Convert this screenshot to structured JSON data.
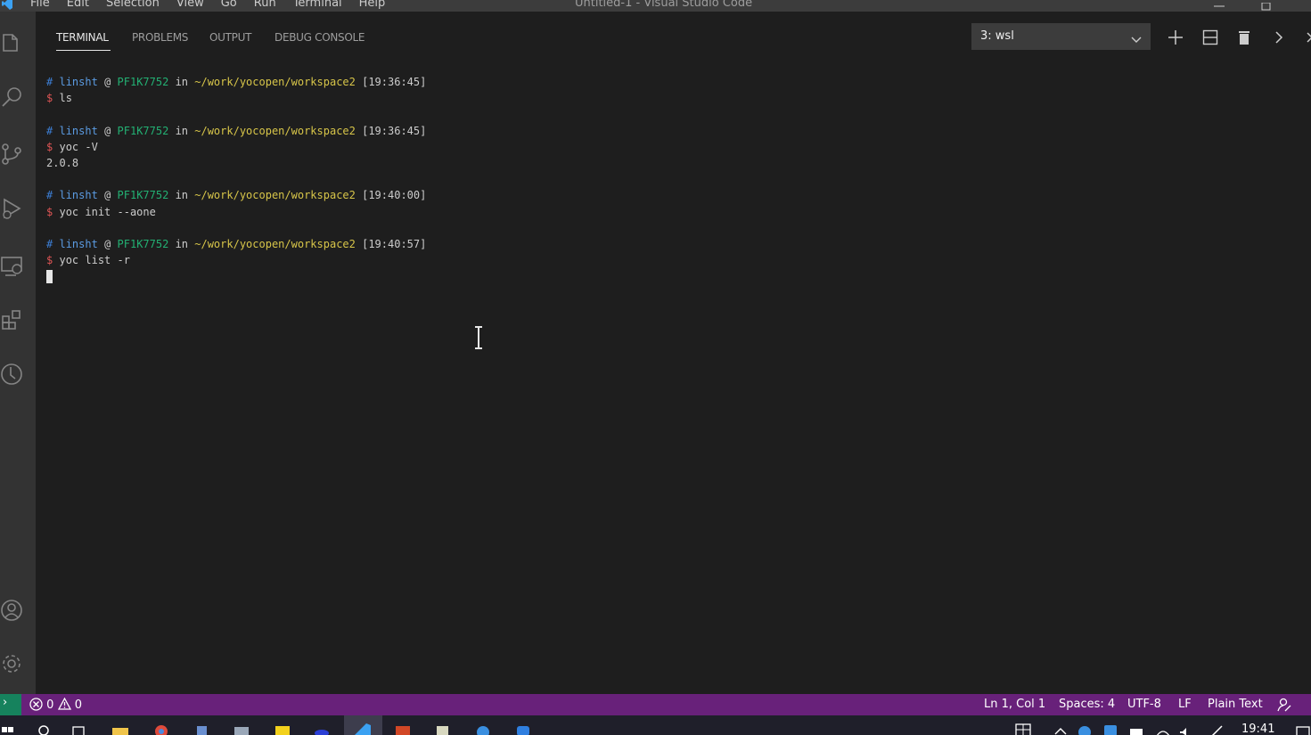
{
  "window": {
    "title": "Untitled-1 - Visual Studio Code",
    "menu": [
      "File",
      "Edit",
      "Selection",
      "View",
      "Go",
      "Run",
      "Terminal",
      "Help"
    ]
  },
  "panel": {
    "tabs": [
      "TERMINAL",
      "PROBLEMS",
      "OUTPUT",
      "DEBUG CONSOLE"
    ],
    "active_tab": "TERMINAL",
    "terminal_selector": "3: wsl"
  },
  "terminal": {
    "blocks": [
      {
        "hash": "#",
        "user": "linsht",
        "at": "@",
        "host": "PF1K7752",
        "in": "in",
        "path": "~/work/yocopen/workspace2",
        "time": "[19:36:45]",
        "prompt": "$",
        "command": "ls",
        "output": ""
      },
      {
        "hash": "#",
        "user": "linsht",
        "at": "@",
        "host": "PF1K7752",
        "in": "in",
        "path": "~/work/yocopen/workspace2",
        "time": "[19:36:45]",
        "prompt": "$",
        "command": "yoc -V",
        "output": "2.0.8"
      },
      {
        "hash": "#",
        "user": "linsht",
        "at": "@",
        "host": "PF1K7752",
        "in": "in",
        "path": "~/work/yocopen/workspace2",
        "time": "[19:40:00]",
        "prompt": "$",
        "command": "yoc init --aone",
        "output": ""
      },
      {
        "hash": "#",
        "user": "linsht",
        "at": "@",
        "host": "PF1K7752",
        "in": "in",
        "path": "~/work/yocopen/workspace2",
        "time": "[19:40:57]",
        "prompt": "$",
        "command": "yoc list -r",
        "output": ""
      }
    ]
  },
  "statusbar": {
    "errors": "0",
    "warnings": "0",
    "position": "Ln 1, Col 1",
    "spaces": "Spaces: 4",
    "encoding": "UTF-8",
    "eol": "LF",
    "language": "Plain Text"
  },
  "taskbar": {
    "clock": "19:41"
  },
  "colors": {
    "accent_status": "#68217a",
    "remote": "#16825d",
    "host": "#23b073",
    "path": "#d7c549",
    "prompt": "#e05555"
  }
}
